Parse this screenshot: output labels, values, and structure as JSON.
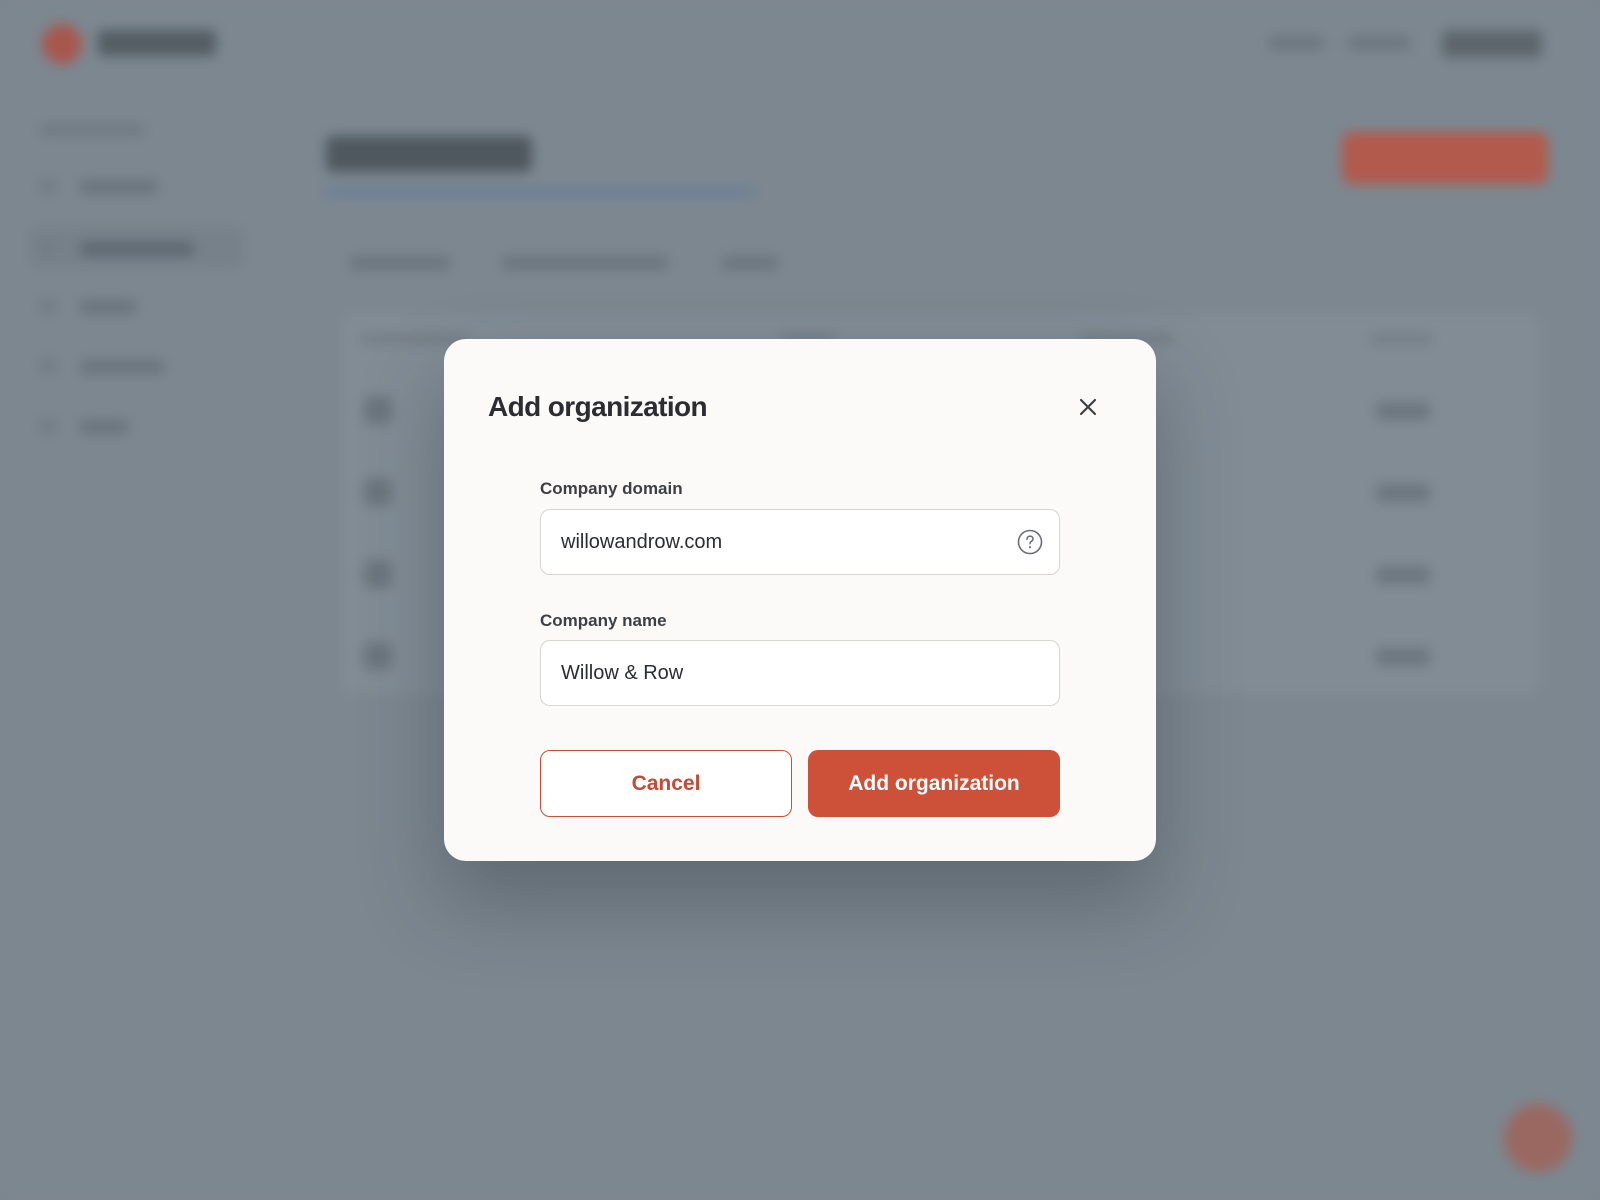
{
  "colors": {
    "accent": "#cd5138",
    "overlay": "#7c8790",
    "modal_background": "#fcfaf8",
    "text_primary": "#2b2d31"
  },
  "modal": {
    "title": "Add organization",
    "close_icon": "close-icon",
    "fields": {
      "domain": {
        "label": "Company domain",
        "value": "willowandrow.com",
        "help_icon": "question-circle-icon"
      },
      "name": {
        "label": "Company name",
        "value": "Willow & Row"
      }
    },
    "actions": {
      "cancel_label": "Cancel",
      "submit_label": "Add organization"
    }
  }
}
